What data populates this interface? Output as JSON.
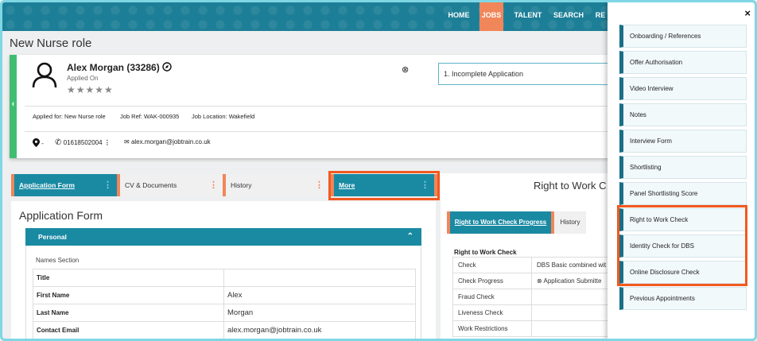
{
  "nav": {
    "items": [
      {
        "label": "HOME",
        "active": false
      },
      {
        "label": "JOBS",
        "active": true
      },
      {
        "label": "TALENT",
        "active": false
      },
      {
        "label": "SEARCH",
        "active": false
      },
      {
        "label": "RE",
        "active": false
      }
    ]
  },
  "page": {
    "title": "New Nurse role"
  },
  "candidate": {
    "name": "Alex Morgan (33286)",
    "applied_on": "Applied On",
    "stars": "★★★★★",
    "status": "1. Incomplete Application",
    "applied_for": "Applied for: New Nurse role",
    "job_ref": "Job Ref: WAK-000935",
    "job_location": "Job Location: Wakefield",
    "location_suffix": "-",
    "phone": "01618502004",
    "email": "alex.morgan@jobtrain.co.uk"
  },
  "tabs": [
    {
      "label": "Application Form",
      "active": true
    },
    {
      "label": "CV & Documents",
      "active": false
    },
    {
      "label": "History",
      "active": false
    },
    {
      "label": "More",
      "active": true
    }
  ],
  "application_form": {
    "title": "Application Form",
    "section": "Personal",
    "subsection": "Names Section",
    "fields": [
      {
        "label": "Title",
        "value": ""
      },
      {
        "label": "First Name",
        "value": "Alex"
      },
      {
        "label": "Last Name",
        "value": "Morgan"
      },
      {
        "label": "Contact Email",
        "value": "alex.morgan@jobtrain.co.uk"
      }
    ]
  },
  "right_panel": {
    "title": "Right to Work C",
    "tabs": [
      "Right to Work Check Progress",
      "History"
    ],
    "section_label": "Right to Work Check",
    "rows": [
      {
        "key": "Check",
        "value": "DBS Basic combined wit"
      },
      {
        "key": "Check Progress",
        "value": "Application Submitte"
      },
      {
        "key": "Fraud Check",
        "value": ""
      },
      {
        "key": "Liveness Check",
        "value": ""
      },
      {
        "key": "Work Restrictions",
        "value": ""
      }
    ]
  },
  "drawer": {
    "close": "×",
    "items": [
      "Onboarding / References",
      "Offer Authorisation",
      "Video Interview",
      "Notes",
      "Interview Form",
      "Shortlisting",
      "Panel Shortlisting Score",
      "Right to Work Check",
      "Identity Check for DBS",
      "Online Disclosure Check",
      "Previous Appointments"
    ]
  },
  "colors": {
    "accent": "#1a8aa3",
    "orange": "#f0865a",
    "highlight": "#f2591e",
    "green": "#3fbe72"
  }
}
